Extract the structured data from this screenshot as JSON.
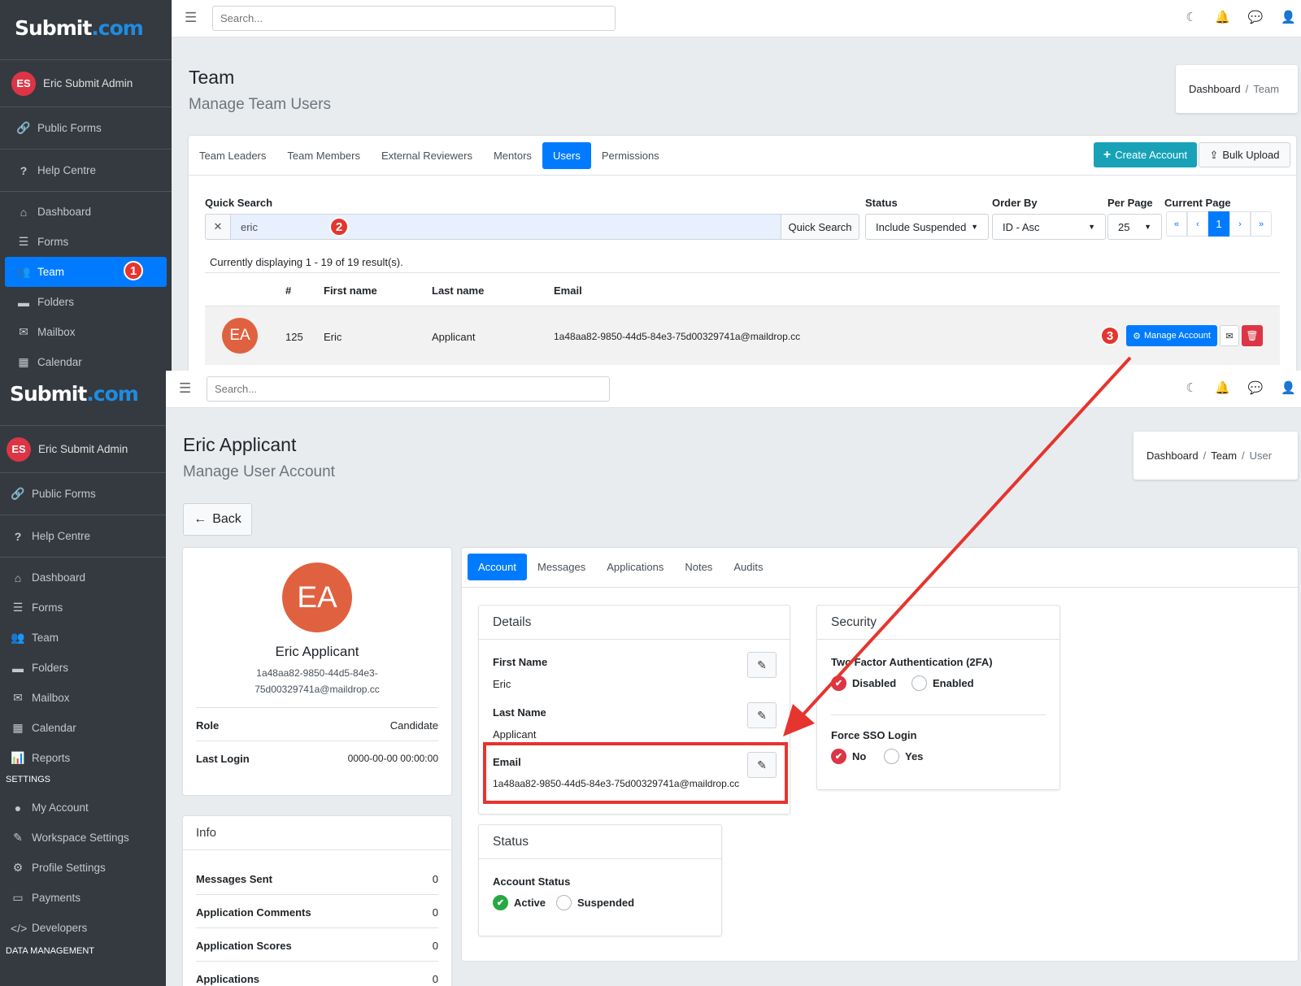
{
  "brand": {
    "name_a": "Submit",
    "name_b": ".com"
  },
  "user": {
    "initials": "ES",
    "name": "Eric Submit Admin"
  },
  "topbar": {
    "search_placeholder": "Search..."
  },
  "icons": {
    "menu": "hamburger-icon",
    "theme": "moon-icon",
    "notifications": "bell-icon",
    "messages": "chat-icon",
    "profile": "user-icon"
  },
  "sidebar1": {
    "public_forms": "Public Forms",
    "help_centre": "Help Centre",
    "items": [
      "Dashboard",
      "Forms",
      "Team",
      "Folders",
      "Mailbox",
      "Calendar"
    ]
  },
  "sidebar2": {
    "public_forms": "Public Forms",
    "help_centre": "Help Centre",
    "items": [
      "Dashboard",
      "Forms",
      "Team",
      "Folders",
      "Mailbox",
      "Calendar",
      "Reports"
    ],
    "settings_header": "SETTINGS",
    "settings": [
      "My Account",
      "Workspace Settings",
      "Profile Settings",
      "Payments",
      "Developers"
    ],
    "data_header": "DATA MANAGEMENT"
  },
  "team_page": {
    "title": "Team",
    "subtitle": "Manage Team Users",
    "breadcrumb": [
      "Dashboard",
      "Team"
    ],
    "tabs": [
      "Team Leaders",
      "Team Members",
      "External Reviewers",
      "Mentors",
      "Users",
      "Permissions"
    ],
    "create_account": "Create Account",
    "bulk_upload": "Bulk Upload",
    "filters": {
      "quick_search_label": "Quick Search",
      "search_value": "eric",
      "quick_search_button": "Quick Search",
      "status_label": "Status",
      "status_value": "Include Suspended",
      "order_label": "Order By",
      "order_value": "ID - Asc",
      "per_page_label": "Per Page",
      "per_page_value": "25",
      "current_page_label": "Current Page",
      "pager": [
        "«",
        "‹",
        "1",
        "›",
        "»"
      ]
    },
    "result_text": "Currently displaying 1 - 19 of 19 result(s).",
    "columns": [
      "#",
      "First name",
      "Last name",
      "Email"
    ],
    "row": {
      "initials": "EA",
      "id": "125",
      "first": "Eric",
      "last": "Applicant",
      "email": "1a48aa82-9850-44d5-84e3-75d00329741a@maildrop.cc"
    },
    "manage_account": "Manage Account"
  },
  "user_page": {
    "title": "Eric Applicant",
    "subtitle": "Manage User Account",
    "breadcrumb": [
      "Dashboard",
      "Team",
      "User"
    ],
    "back": "Back",
    "profile": {
      "initials": "EA",
      "name": "Eric Applicant",
      "email_line1": "1a48aa82-9850-44d5-84e3-",
      "email_line2": "75d00329741a@maildrop.cc",
      "role_label": "Role",
      "role_value": "Candidate",
      "last_login_label": "Last Login",
      "last_login_value": "0000-00-00 00:00:00"
    },
    "info": {
      "title": "Info",
      "rows": [
        {
          "label": "Messages Sent",
          "value": "0"
        },
        {
          "label": "Application Comments",
          "value": "0"
        },
        {
          "label": "Application Scores",
          "value": "0"
        },
        {
          "label": "Applications",
          "value": "0"
        }
      ]
    },
    "tabs": [
      "Account",
      "Messages",
      "Applications",
      "Notes",
      "Audits"
    ],
    "details": {
      "title": "Details",
      "first_name_label": "First Name",
      "first_name": "Eric",
      "last_name_label": "Last Name",
      "last_name": "Applicant",
      "email_label": "Email",
      "email": "1a48aa82-9850-44d5-84e3-75d00329741a@maildrop.cc"
    },
    "security": {
      "title": "Security",
      "tfa_label": "Two Factor Authentication (2FA)",
      "tfa_options": [
        "Disabled",
        "Enabled"
      ],
      "sso_label": "Force SSO Login",
      "sso_options": [
        "No",
        "Yes"
      ]
    },
    "status": {
      "title": "Status",
      "label": "Account Status",
      "options": [
        "Active",
        "Suspended"
      ]
    }
  },
  "annotations": {
    "step1": "1",
    "step2": "2",
    "step3": "3",
    "color": "#e5352e"
  }
}
